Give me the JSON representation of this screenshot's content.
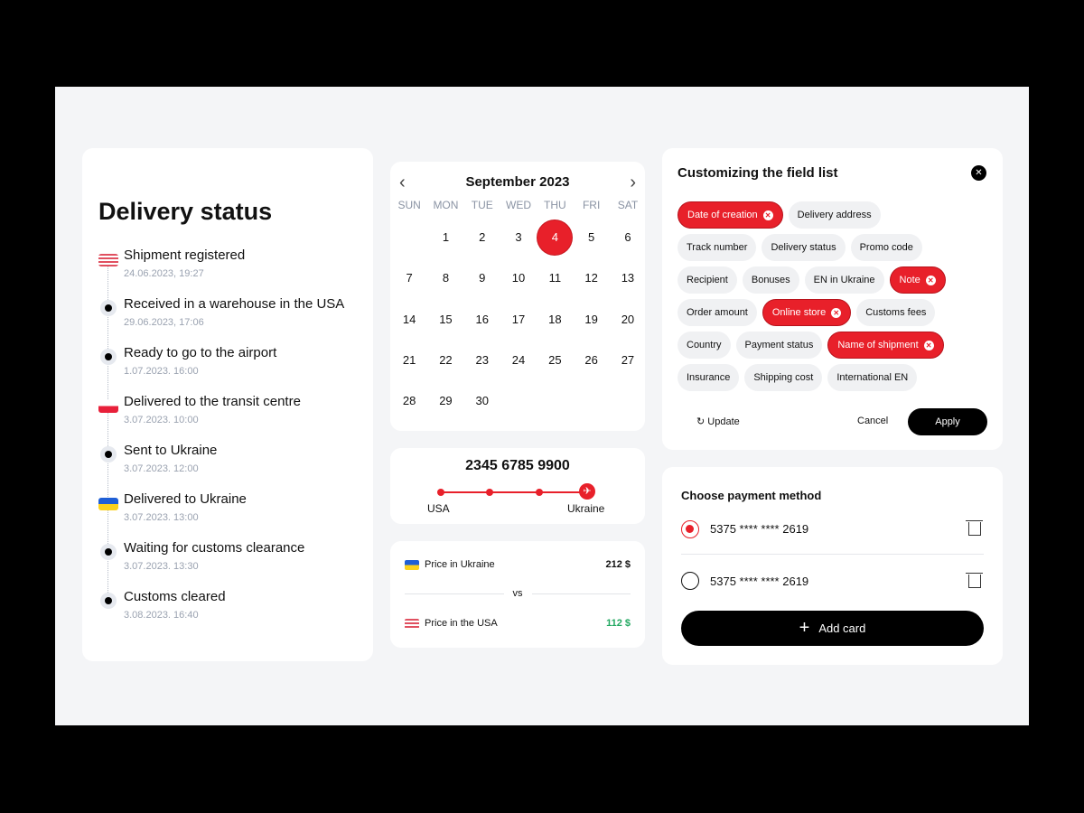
{
  "delivery": {
    "title": "Delivery status",
    "steps": [
      {
        "label": "Shipment registered",
        "date": "24.06.2023, 19:27",
        "icon": "flag-usa"
      },
      {
        "label": "Received in a warehouse in the USA",
        "date": "29.06.2023, 17:06",
        "icon": "dot"
      },
      {
        "label": "Ready to go to the airport",
        "date": "1.07.2023. 16:00",
        "icon": "dot"
      },
      {
        "label": "Delivered to the transit centre",
        "date": "3.07.2023. 10:00",
        "icon": "flag-poland"
      },
      {
        "label": "Sent to Ukraine",
        "date": "3.07.2023. 12:00",
        "icon": "dot"
      },
      {
        "label": "Delivered to Ukraine",
        "date": "3.07.2023. 13:00",
        "icon": "flag-ukraine"
      },
      {
        "label": "Waiting for customs clearance",
        "date": "3.07.2023. 13:30",
        "icon": "dot"
      },
      {
        "label": "Customs cleared",
        "date": "3.08.2023. 16:40",
        "icon": "dot"
      }
    ]
  },
  "calendar": {
    "month": "September 2023",
    "weekdays": [
      "SUN",
      "MON",
      "TUE",
      "WED",
      "THU",
      "FRI",
      "SAT"
    ],
    "start_offset": 1,
    "days": 30,
    "selected": 4
  },
  "tracking": {
    "number": "2345 6785 9900",
    "from": "USA",
    "to": "Ukraine"
  },
  "price": {
    "ukraine_label": "Price in Ukraine",
    "ukraine_value": "212 $",
    "vs": "vs",
    "usa_label": "Price in the USA",
    "usa_value": "112 $",
    "accent_green": "#22a861"
  },
  "fields": {
    "title": "Customizing the field list",
    "rows": [
      [
        {
          "label": "Date of creation",
          "on": true
        },
        {
          "label": "Delivery address",
          "on": false
        }
      ],
      [
        {
          "label": "Track number",
          "on": false
        },
        {
          "label": "Delivery status",
          "on": false
        },
        {
          "label": "Promo code",
          "on": false
        }
      ],
      [
        {
          "label": "Recipient",
          "on": false
        },
        {
          "label": "Bonuses",
          "on": false
        },
        {
          "label": "EN in Ukraine",
          "on": false
        },
        {
          "label": "Note",
          "on": true
        }
      ],
      [
        {
          "label": "Order amount",
          "on": false
        },
        {
          "label": "Online store",
          "on": true
        },
        {
          "label": "Customs fees",
          "on": false
        }
      ],
      [
        {
          "label": "Country",
          "on": false
        },
        {
          "label": "Payment status",
          "on": false
        },
        {
          "label": "Name of shipment",
          "on": true
        }
      ],
      [
        {
          "label": "Insurance",
          "on": false
        },
        {
          "label": "Shipping cost",
          "on": false
        },
        {
          "label": "International EN",
          "on": false
        }
      ]
    ],
    "update": "Update",
    "cancel": "Cancel",
    "apply": "Apply"
  },
  "payment": {
    "title": "Choose payment method",
    "cards": [
      {
        "number": "5375 **** **** 2619",
        "selected": true
      },
      {
        "number": "5375 **** **** 2619",
        "selected": false
      }
    ],
    "add": "Add card"
  },
  "colors": {
    "accent": "#e8202a"
  }
}
